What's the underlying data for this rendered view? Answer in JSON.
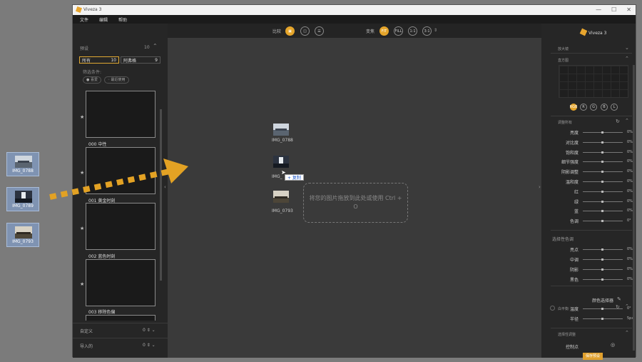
{
  "desktop": {
    "files": [
      {
        "name": "IMG_0788"
      },
      {
        "name": "IMG_0789"
      },
      {
        "name": "IMG_0793"
      }
    ]
  },
  "window": {
    "title": "Viveza 3",
    "menu": [
      "文件",
      "编辑",
      "帮助"
    ]
  },
  "left": {
    "presets_label": "预设",
    "presets_count": "10",
    "tabs": [
      {
        "label": "所有",
        "count": "10"
      },
      {
        "label": "阿弗格",
        "count": "9"
      }
    ],
    "filter_label": "筛选条件:",
    "chips": [
      "● 喜爱",
      "◦ 最近使用"
    ],
    "presets": [
      "000 中性",
      "001 黄金时刻",
      "002 蓝色时刻",
      "003 移除色偏"
    ],
    "custom_label": "自定义",
    "custom_count": "0",
    "imported_label": "导入的",
    "imported_count": "0"
  },
  "toolbar": {
    "compare_label": "比较",
    "zoom_label": "变焦",
    "zoom_fit": "FIT",
    "zoom_fill": "FILL",
    "zoom_1": "1:1",
    "zoom_3": "3:1"
  },
  "canvas": {
    "images": [
      "IMG_0788",
      "IMG_0789",
      "IMG_0793"
    ],
    "img2_label_partial": "IMG_",
    "copy_badge": "+ 复制",
    "drop_hint": "将您的图片拖放到此处或使用 Ctrl + O"
  },
  "right": {
    "title": "Viveza 3",
    "loupe": "放大镜",
    "histogram": "直方图",
    "channels": [
      "RGB",
      "R",
      "G",
      "B",
      "L"
    ],
    "global_section": "调整所有",
    "global_sliders": [
      {
        "label": "亮度",
        "value": "0%"
      },
      {
        "label": "对比度",
        "value": "0%"
      },
      {
        "label": "饱和度",
        "value": "0%"
      },
      {
        "label": "细节强度",
        "value": "0%"
      },
      {
        "label": "阴影调整",
        "value": "0%"
      },
      {
        "label": "温和度",
        "value": "0%"
      },
      {
        "label": "红",
        "value": "0%"
      },
      {
        "label": "绿",
        "value": "0%"
      },
      {
        "label": "蓝",
        "value": "0%"
      },
      {
        "label": "色调",
        "value": "0°"
      }
    ],
    "selective_color": "选择性色调",
    "selective_sliders": [
      {
        "label": "亮点",
        "value": "0%"
      },
      {
        "label": "中调",
        "value": "0%"
      },
      {
        "label": "阴影",
        "value": "0%"
      },
      {
        "label": "黑色",
        "value": "0%"
      }
    ],
    "wb_section": "白平衡",
    "color_picker": "颜色选择器",
    "wb_sliders": [
      {
        "label": "温度",
        "value": "0°"
      },
      {
        "label": "半径",
        "value": "5px"
      }
    ],
    "control_section": "选择性调整",
    "control_point": "控制点",
    "save_button": "保存预设"
  }
}
